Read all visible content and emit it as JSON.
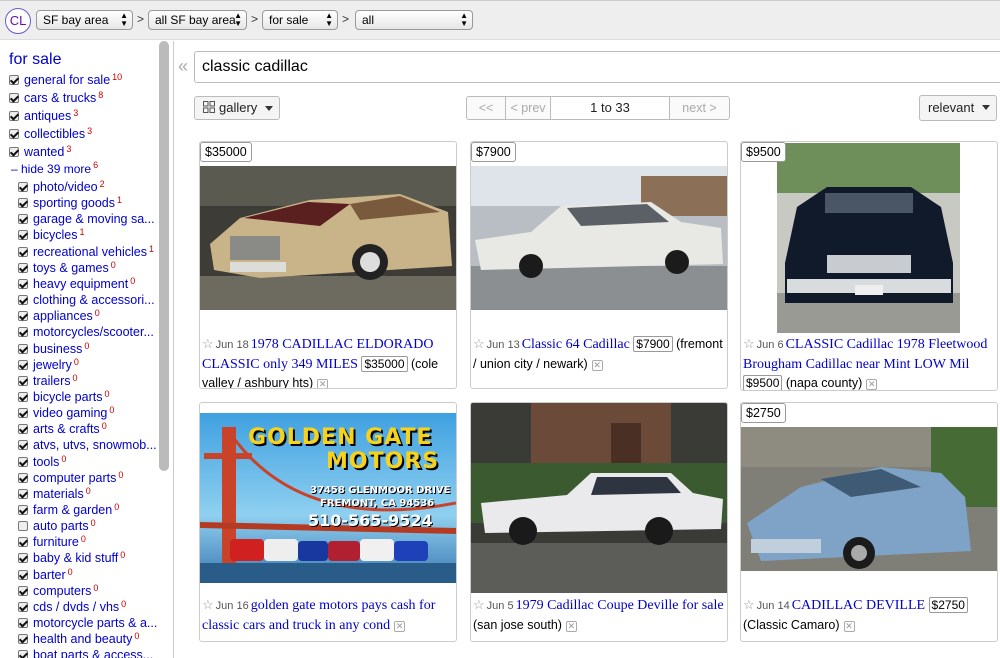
{
  "topbar": {
    "logo": "CL",
    "area": "SF bay area",
    "subarea": "all SF bay area",
    "category": "for sale",
    "subcategory": "all",
    "sep": ">"
  },
  "sidebar": {
    "title": "for sale",
    "top_items": [
      {
        "label": "general for sale",
        "count": "10",
        "checked": true
      },
      {
        "label": "cars & trucks",
        "count": "8",
        "checked": true
      },
      {
        "label": "antiques",
        "count": "3",
        "checked": true
      },
      {
        "label": "collectibles",
        "count": "3",
        "checked": true
      },
      {
        "label": "wanted",
        "count": "3",
        "checked": true
      }
    ],
    "hide_more": "– hide 39 more",
    "hide_count": "6",
    "sub_items": [
      {
        "label": "photo/video",
        "count": "2",
        "checked": true
      },
      {
        "label": "sporting goods",
        "count": "1",
        "checked": true
      },
      {
        "label": "garage & moving sa...",
        "count": "",
        "checked": true
      },
      {
        "label": "bicycles",
        "count": "1",
        "checked": true
      },
      {
        "label": "recreational vehicles",
        "count": "1",
        "checked": true
      },
      {
        "label": "toys & games",
        "count": "0",
        "checked": true
      },
      {
        "label": "heavy equipment",
        "count": "0",
        "checked": true
      },
      {
        "label": "clothing & accessori...",
        "count": "",
        "checked": true
      },
      {
        "label": "appliances",
        "count": "0",
        "checked": true
      },
      {
        "label": "motorcycles/scooter...",
        "count": "",
        "checked": true
      },
      {
        "label": "business",
        "count": "0",
        "checked": true
      },
      {
        "label": "jewelry",
        "count": "0",
        "checked": true
      },
      {
        "label": "trailers",
        "count": "0",
        "checked": true
      },
      {
        "label": "bicycle parts",
        "count": "0",
        "checked": true
      },
      {
        "label": "video gaming",
        "count": "0",
        "checked": true
      },
      {
        "label": "arts & crafts",
        "count": "0",
        "checked": true
      },
      {
        "label": "atvs, utvs, snowmob...",
        "count": "",
        "checked": true
      },
      {
        "label": "tools",
        "count": "0",
        "checked": true
      },
      {
        "label": "computer parts",
        "count": "0",
        "checked": true
      },
      {
        "label": "materials",
        "count": "0",
        "checked": true
      },
      {
        "label": "farm & garden",
        "count": "0",
        "checked": true
      },
      {
        "label": "auto parts",
        "count": "0",
        "checked": false
      },
      {
        "label": "furniture",
        "count": "0",
        "checked": true
      },
      {
        "label": "baby & kid stuff",
        "count": "0",
        "checked": true
      },
      {
        "label": "barter",
        "count": "0",
        "checked": true
      },
      {
        "label": "computers",
        "count": "0",
        "checked": true
      },
      {
        "label": "cds / dvds / vhs",
        "count": "0",
        "checked": true
      },
      {
        "label": "motorcycle parts & a...",
        "count": "",
        "checked": true
      },
      {
        "label": "health and beauty",
        "count": "0",
        "checked": true
      },
      {
        "label": "boat parts & access...",
        "count": "",
        "checked": true
      }
    ]
  },
  "search": {
    "query": "classic cadillac"
  },
  "toolbar": {
    "view": "gallery",
    "first": "<<",
    "prev": "< prev",
    "range": "1 to 33",
    "next": "next >",
    "sort": "relevant"
  },
  "listings": [
    {
      "price_tag": "$35000",
      "star": "☆",
      "date": "Jun 18",
      "title": "1978 CADILLAC ELDORADO CLASSIC only 349 MILES",
      "price": "$35000",
      "location": "(cole valley / ashbury hts)"
    },
    {
      "price_tag": "$7900",
      "star": "☆",
      "date": "Jun 13",
      "title": "Classic 64 Cadillac",
      "price": "$7900",
      "location": "(fremont / union city / newark)"
    },
    {
      "price_tag": "$9500",
      "star": "☆",
      "date": "Jun 6",
      "title": "CLASSIC Cadillac 1978 Fleetwood Brougham Cadillac near Mint LOW Mil",
      "price": "$9500",
      "location": "(napa county)"
    },
    {
      "price_tag": "",
      "star": "☆",
      "date": "Jun 16",
      "title": "golden gate motors pays cash for classic cars and truck in any cond",
      "price": "",
      "location": "",
      "ad": {
        "line1": "GOLDEN GATE",
        "line2": "MOTORS",
        "addr1": "37458 GLENMOOR DRIVE",
        "addr2": "FREMONT, CA 94536",
        "phone": "510-565-9524"
      }
    },
    {
      "price_tag": "",
      "star": "☆",
      "date": "Jun 5",
      "title": "1979 Cadillac Coupe Deville for sale",
      "price": "",
      "location": "(san jose south)"
    },
    {
      "price_tag": "$2750",
      "star": "☆",
      "date": "Jun 14",
      "title": "CADILLAC DEVILLE",
      "price": "$2750",
      "location": "(Classic Camaro)"
    }
  ],
  "icons": {
    "x": "✕"
  }
}
